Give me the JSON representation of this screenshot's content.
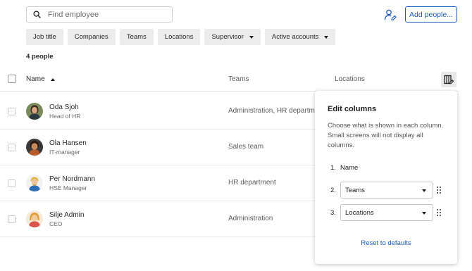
{
  "search": {
    "placeholder": "Find employee",
    "icon": "search-icon"
  },
  "actions": {
    "add_label": "Add people...",
    "user_icon": "user-edit-icon"
  },
  "filters": [
    {
      "label": "Job title",
      "dropdown": false
    },
    {
      "label": "Companies",
      "dropdown": false
    },
    {
      "label": "Teams",
      "dropdown": false
    },
    {
      "label": "Locations",
      "dropdown": false
    },
    {
      "label": "Supervisor",
      "dropdown": true
    },
    {
      "label": "Active accounts",
      "dropdown": true
    }
  ],
  "count_label": "4 people",
  "table": {
    "headers": {
      "name": "Name",
      "teams": "Teams",
      "locations": "Locations"
    },
    "sort": "ascending",
    "rows": [
      {
        "name": "Oda Sjoh",
        "role": "Head of HR",
        "teams": "Administration, HR department",
        "avatar": "avatar-oda"
      },
      {
        "name": "Ola Hansen",
        "role": "IT-manager",
        "teams": "Sales team",
        "avatar": "avatar-ola"
      },
      {
        "name": "Per Nordmann",
        "role": "HSE Manager",
        "teams": "HR department",
        "avatar": "avatar-per"
      },
      {
        "name": "Silje Admin",
        "role": "CEO",
        "teams": "Administration",
        "avatar": "avatar-silje"
      }
    ]
  },
  "edit_columns": {
    "title": "Edit columns",
    "description": "Choose what is shown in each column. Small screens will not display all columns.",
    "items": [
      {
        "num": "1.",
        "label": "Name"
      },
      {
        "num": "2.",
        "label": "Teams"
      },
      {
        "num": "3.",
        "label": "Locations"
      }
    ],
    "reset_label": "Reset to defaults"
  },
  "colors": {
    "accent": "#1d5bb8",
    "chip_bg": "#ececec",
    "border": "#cfcfcf"
  }
}
